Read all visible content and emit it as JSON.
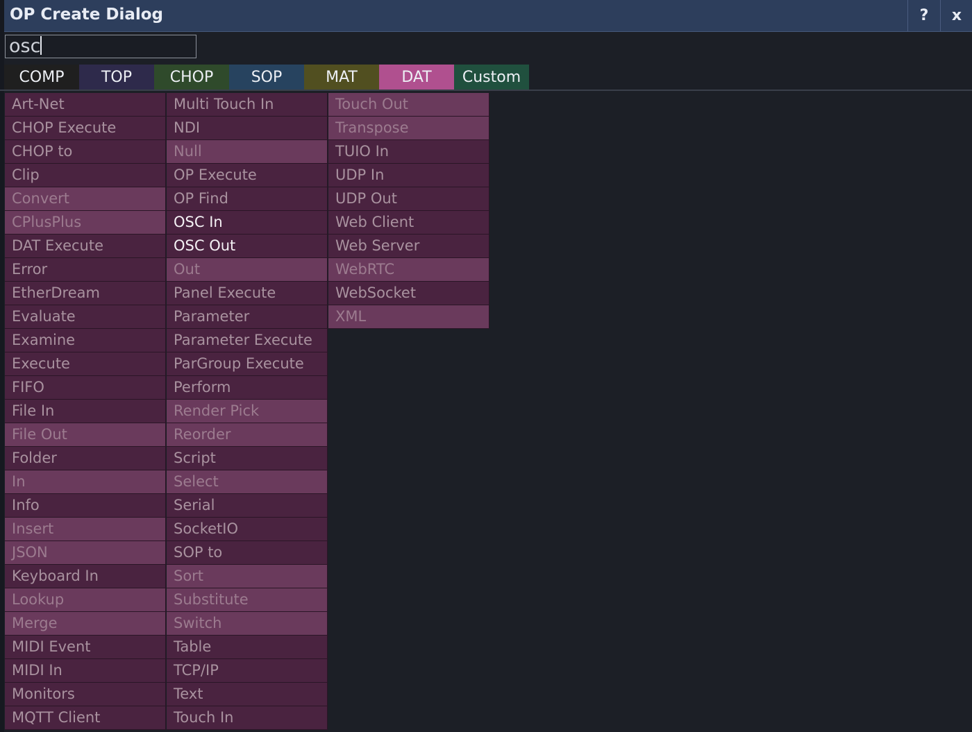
{
  "window": {
    "title": "OP Create Dialog",
    "help_label": "?",
    "close_label": "x"
  },
  "search": {
    "value": "osc"
  },
  "tabs": [
    {
      "label": "COMP",
      "color": "#1f1f1f"
    },
    {
      "label": "TOP",
      "color": "#2e2a4b"
    },
    {
      "label": "CHOP",
      "color": "#2f4a2b"
    },
    {
      "label": "SOP",
      "color": "#27435f"
    },
    {
      "label": "MAT",
      "color": "#514f20"
    },
    {
      "label": "DAT",
      "color": "#b0508f"
    },
    {
      "label": "Custom",
      "color": "#20503e"
    }
  ],
  "selected_tab": "DAT",
  "operators": {
    "columns": [
      [
        {
          "label": "Art-Net"
        },
        {
          "label": "CHOP Execute"
        },
        {
          "label": "CHOP to"
        },
        {
          "label": "Clip"
        },
        {
          "label": "Convert",
          "dim": true
        },
        {
          "label": "CPlusPlus",
          "dim": true
        },
        {
          "label": "DAT Execute"
        },
        {
          "label": "Error"
        },
        {
          "label": "EtherDream"
        },
        {
          "label": "Evaluate"
        },
        {
          "label": "Examine"
        },
        {
          "label": "Execute"
        },
        {
          "label": "FIFO"
        },
        {
          "label": "File In"
        },
        {
          "label": "File Out",
          "dim": true
        },
        {
          "label": "Folder"
        },
        {
          "label": "In",
          "dim": true
        },
        {
          "label": "Info"
        },
        {
          "label": "Insert",
          "dim": true
        },
        {
          "label": "JSON",
          "dim": true
        },
        {
          "label": "Keyboard In"
        },
        {
          "label": "Lookup",
          "dim": true
        },
        {
          "label": "Merge",
          "dim": true
        },
        {
          "label": "MIDI Event"
        },
        {
          "label": "MIDI In"
        },
        {
          "label": "Monitors"
        },
        {
          "label": "MQTT Client"
        }
      ],
      [
        {
          "label": "Multi Touch In"
        },
        {
          "label": "NDI"
        },
        {
          "label": "Null",
          "dim": true
        },
        {
          "label": "OP Execute"
        },
        {
          "label": "OP Find"
        },
        {
          "label": "OSC In",
          "highlight": true
        },
        {
          "label": "OSC Out",
          "highlight": true
        },
        {
          "label": "Out",
          "dim": true
        },
        {
          "label": "Panel Execute"
        },
        {
          "label": "Parameter"
        },
        {
          "label": "Parameter Execute"
        },
        {
          "label": "ParGroup Execute"
        },
        {
          "label": "Perform"
        },
        {
          "label": "Render Pick",
          "dim": true
        },
        {
          "label": "Reorder",
          "dim": true
        },
        {
          "label": "Script"
        },
        {
          "label": "Select",
          "dim": true
        },
        {
          "label": "Serial"
        },
        {
          "label": "SocketIO"
        },
        {
          "label": "SOP to"
        },
        {
          "label": "Sort",
          "dim": true
        },
        {
          "label": "Substitute",
          "dim": true
        },
        {
          "label": "Switch",
          "dim": true
        },
        {
          "label": "Table"
        },
        {
          "label": "TCP/IP"
        },
        {
          "label": "Text"
        },
        {
          "label": "Touch In"
        }
      ],
      [
        {
          "label": "Touch Out",
          "dim": true
        },
        {
          "label": "Transpose",
          "dim": true
        },
        {
          "label": "TUIO In"
        },
        {
          "label": "UDP In"
        },
        {
          "label": "UDP Out"
        },
        {
          "label": "Web Client"
        },
        {
          "label": "Web Server"
        },
        {
          "label": "WebRTC",
          "dim": true
        },
        {
          "label": "WebSocket"
        },
        {
          "label": "XML",
          "dim": true
        }
      ]
    ]
  }
}
